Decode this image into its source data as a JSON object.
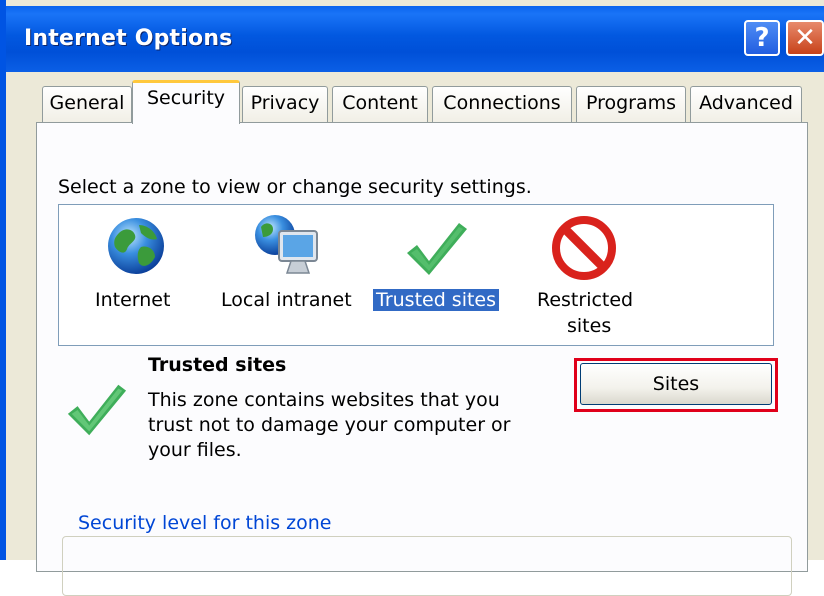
{
  "window": {
    "title": "Internet Options",
    "help_glyph": "?",
    "close_glyph": "✕"
  },
  "tabs": [
    {
      "label": "General",
      "active": false
    },
    {
      "label": "Security",
      "active": true
    },
    {
      "label": "Privacy",
      "active": false
    },
    {
      "label": "Content",
      "active": false
    },
    {
      "label": "Connections",
      "active": false
    },
    {
      "label": "Programs",
      "active": false
    },
    {
      "label": "Advanced",
      "active": false
    }
  ],
  "security": {
    "instruction": "Select a zone to view or change security settings.",
    "zones": [
      {
        "label": "Internet",
        "icon": "globe-icon",
        "selected": false
      },
      {
        "label": "Local intranet",
        "icon": "intranet-icon",
        "selected": false
      },
      {
        "label": "Trusted sites",
        "icon": "checkmark-icon",
        "selected": true
      },
      {
        "label": "Restricted sites",
        "label_line1": "Restricted",
        "label_line2": "sites",
        "icon": "restricted-icon",
        "selected": false
      }
    ],
    "selected_zone": {
      "title": "Trusted sites",
      "description": "This zone contains websites that you trust not to damage your computer or your files.",
      "icon": "checkmark-icon"
    },
    "sites_button_label": "Sites",
    "security_level_legend": "Security level for this zone"
  },
  "colors": {
    "titlebar": "#0054e3",
    "selection": "#316ac5",
    "highlight_box": "#e0001a",
    "group_legend": "#0046d5",
    "checkmark": "#3fae5a",
    "restricted": "#d9221c"
  }
}
